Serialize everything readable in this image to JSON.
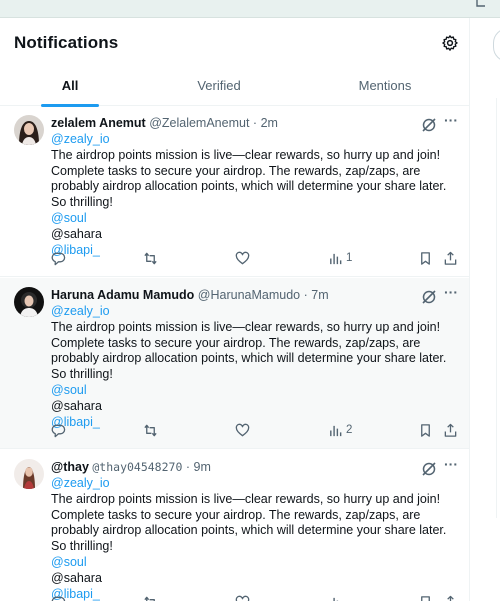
{
  "header": {
    "title": "Notifications",
    "settings_icon": "gear-icon"
  },
  "tabs": [
    {
      "label": "All",
      "active": true
    },
    {
      "label": "Verified",
      "active": false
    },
    {
      "label": "Mentions",
      "active": false
    }
  ],
  "colors": {
    "accent": "#1d9bf0",
    "text": "#0f1419",
    "muted": "#536471",
    "row_highlight": "#f7f9f9"
  },
  "posts": [
    {
      "name": "zelalem Anemut",
      "handle": "@ZelalemAnemut",
      "time": "2m",
      "lines": [
        {
          "text": "@zealy_io",
          "link": true
        },
        {
          "text": "The airdrop points mission is live—clear rewards, so hurry up and join! Complete tasks to secure your airdrop. The rewards, zap/zaps, are probably airdrop allocation points, which will determine your share later. So thrilling!",
          "link": false
        },
        {
          "text": "@soul",
          "link": true
        },
        {
          "text": "@sahara",
          "link": false
        },
        {
          "text": "@libapi_",
          "link": true
        }
      ],
      "views": "1"
    },
    {
      "name": "Haruna Adamu Mamudo",
      "handle": "@HarunaMamudo",
      "time": "7m",
      "lines": [
        {
          "text": "@zealy_io",
          "link": true
        },
        {
          "text": "The airdrop points mission is live—clear rewards, so hurry up and join! Complete tasks to secure your airdrop. The rewards, zap/zaps, are probably airdrop allocation points, which will determine your share later. So thrilling!",
          "link": false
        },
        {
          "text": "@soul",
          "link": true
        },
        {
          "text": "@sahara",
          "link": false
        },
        {
          "text": "@libapi_",
          "link": true
        }
      ],
      "views": "2"
    },
    {
      "name": "@thay",
      "handle": "@thay04548270",
      "time": "9m",
      "lines": [
        {
          "text": "@zealy_io",
          "link": true
        },
        {
          "text": "The airdrop points mission is live—clear rewards, so hurry up and join! Complete tasks to secure your airdrop. The rewards, zap/zaps, are probably airdrop allocation points, which will determine your share later. So thrilling!",
          "link": false
        },
        {
          "text": "@soul",
          "link": true
        },
        {
          "text": "@sahara",
          "link": false
        },
        {
          "text": "@libapi_",
          "link": true
        }
      ],
      "views": ""
    }
  ],
  "separator": "·",
  "icons": {
    "reply": "reply-icon",
    "repost": "repost-icon",
    "like": "like-icon",
    "views": "views-icon",
    "bookmark": "bookmark-icon",
    "share": "share-icon",
    "grok": "grok-icon",
    "more": "more-icon"
  }
}
